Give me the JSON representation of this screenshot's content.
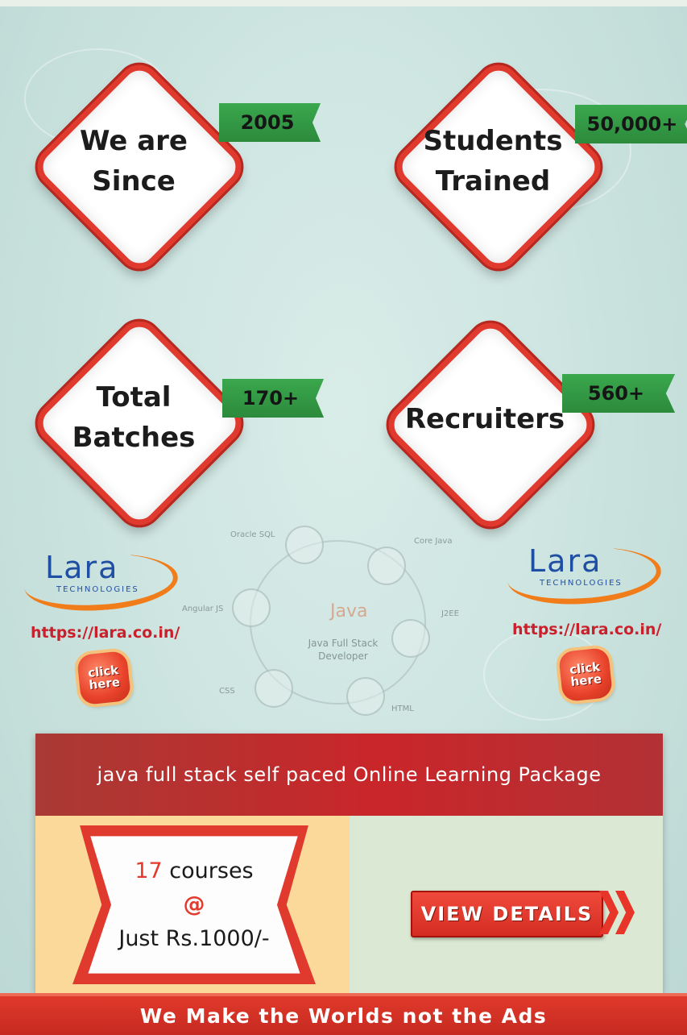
{
  "stats": [
    {
      "label": "We are\nSince",
      "value": "2005"
    },
    {
      "label": "Students\nTrained",
      "value": "50,000+"
    },
    {
      "label": "Total\nBatches",
      "value": "170+"
    },
    {
      "label": "Recruiters",
      "value": "560+"
    }
  ],
  "logo": {
    "name": "Lara",
    "sub": "TECHNOLOGIES"
  },
  "links": {
    "url_left": "https://lara.co.in/",
    "url_right": "https://lara.co.in/",
    "click_line1": "click",
    "click_line2": "here"
  },
  "wheel": {
    "center_word": "Java",
    "center_sub": "Java Full Stack\nDeveloper",
    "topics": [
      "Oracle SQL",
      "Core Java",
      "J2EE",
      "HTML",
      "CSS",
      "Angular JS"
    ]
  },
  "package": {
    "title": "java full stack self paced Online Learning Package",
    "count": "17",
    "count_suffix": " courses",
    "at": "@",
    "price": "Just Rs.1000/-",
    "button": "VIEW DETAILS"
  },
  "footer": {
    "tagline": "We Make  the Worlds not the Ads"
  },
  "colors": {
    "accent_red": "#e03a2f",
    "ribbon_green": "#2e8b3e",
    "logo_blue": "#1f4fa3",
    "logo_orange": "#f07d1a"
  }
}
